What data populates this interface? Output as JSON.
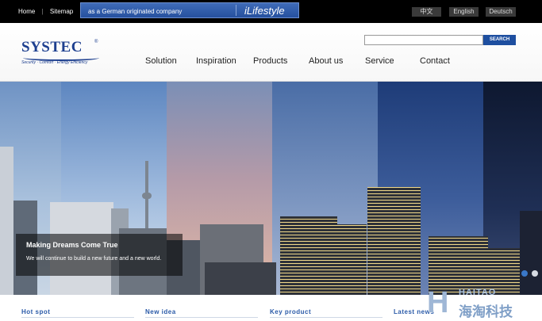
{
  "topbar": {
    "links": [
      "Home",
      "Sitemap"
    ],
    "promo_text": "as a German originated company",
    "promo_brand": "iLifestyle",
    "languages": [
      "中文",
      "English",
      "Deutsch"
    ]
  },
  "header": {
    "logo_word": "SYSTEC",
    "logo_reg": "®",
    "logo_tagline": "Security · Comfort · Energy Efficiency",
    "search_placeholder": "",
    "search_button": "SEARCH",
    "nav": [
      "Solution",
      "Inspiration",
      "Products",
      "About us",
      "Service",
      "Contact"
    ]
  },
  "hero": {
    "title": "Making Dreams Come True",
    "subtitle": "We will continue to build a new future and a new world.",
    "active_slide": 1,
    "slide_count": 2
  },
  "footer": {
    "sections": [
      "Hot spot",
      "New idea",
      "Key product",
      "Latest news"
    ]
  },
  "watermark": {
    "letter": "H",
    "line1": "HAITAO",
    "line2": "海淘科技"
  },
  "colors": {
    "brand_blue": "#1d3f8f",
    "section_blue": "#2a5aa8",
    "topbar": "#000000"
  }
}
